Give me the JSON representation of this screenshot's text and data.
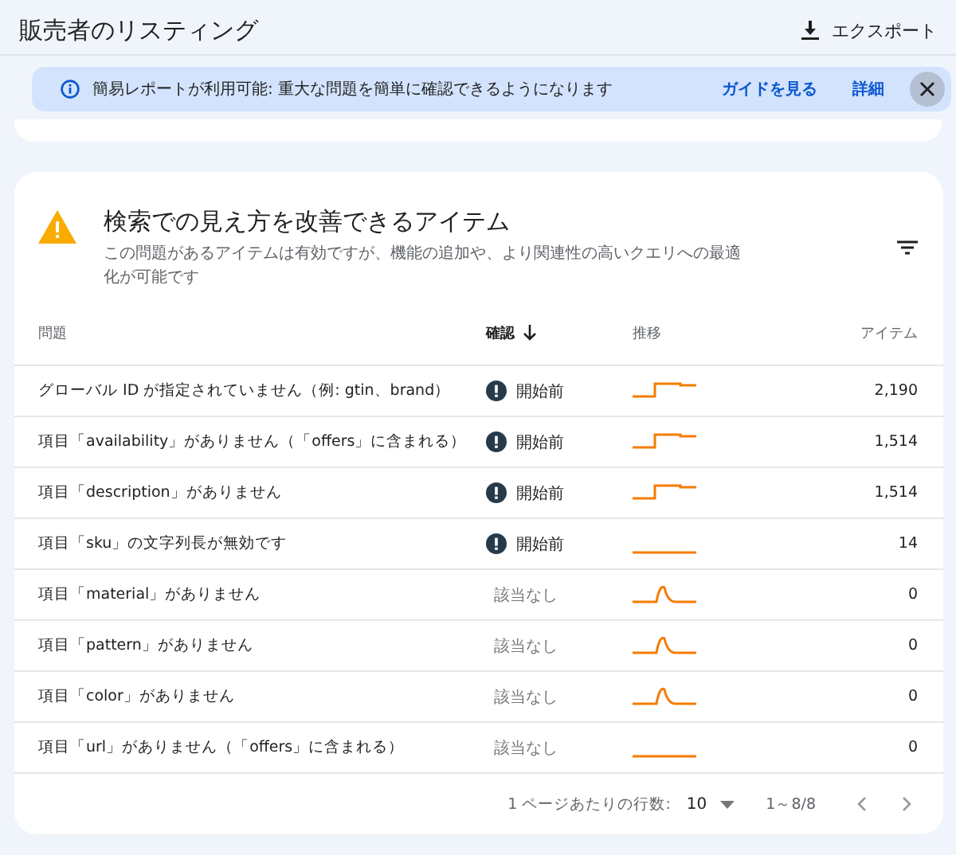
{
  "header": {
    "title": "販売者のリスティング",
    "export_label": "エクスポート"
  },
  "banner": {
    "text": "簡易レポートが利用可能: 重大な問題を簡単に確認できるようになります",
    "guide_link": "ガイドを見る",
    "details_link": "詳細"
  },
  "card": {
    "title": "検索での見え方を改善できるアイテム",
    "description": "この問題があるアイテムは有効ですが、機能の追加や、より関連性の高いクエリへの最適化が可能です"
  },
  "table": {
    "columns": [
      {
        "label": "問題",
        "sorted": false
      },
      {
        "label": "確認",
        "sorted": true
      },
      {
        "label": "推移",
        "sorted": false
      },
      {
        "label": "アイテム",
        "sorted": false
      }
    ],
    "rows": [
      {
        "issue": "グローバル ID が指定されていません（例: gtin、brand）",
        "status": {
          "kind": "pending",
          "text": "開始前"
        },
        "trend": {
          "kind": "step"
        },
        "items": "2,190"
      },
      {
        "issue": "項目「availability」がありません（「offers」に含まれる）",
        "status": {
          "kind": "pending",
          "text": "開始前"
        },
        "trend": {
          "kind": "step"
        },
        "items": "1,514"
      },
      {
        "issue": "項目「description」がありません",
        "status": {
          "kind": "pending",
          "text": "開始前"
        },
        "trend": {
          "kind": "step"
        },
        "items": "1,514"
      },
      {
        "issue": "項目「sku」の文字列長が無効です",
        "status": {
          "kind": "pending",
          "text": "開始前"
        },
        "trend": {
          "kind": "flat"
        },
        "items": "14"
      },
      {
        "issue": "項目「material」がありません",
        "status": {
          "kind": "none",
          "text": "該当なし"
        },
        "trend": {
          "kind": "peak"
        },
        "items": "0"
      },
      {
        "issue": "項目「pattern」がありません",
        "status": {
          "kind": "none",
          "text": "該当なし"
        },
        "trend": {
          "kind": "peak"
        },
        "items": "0"
      },
      {
        "issue": "項目「color」がありません",
        "status": {
          "kind": "none",
          "text": "該当なし"
        },
        "trend": {
          "kind": "peak"
        },
        "items": "0"
      },
      {
        "issue": "項目「url」がありません（「offers」に含まれる）",
        "status": {
          "kind": "none",
          "text": "該当なし"
        },
        "trend": {
          "kind": "flat"
        },
        "items": "0"
      }
    ]
  },
  "pagination": {
    "rows_per_page_label": "1 ページあたりの行数:",
    "rows_per_page": "10",
    "range": "1～8/8"
  }
}
